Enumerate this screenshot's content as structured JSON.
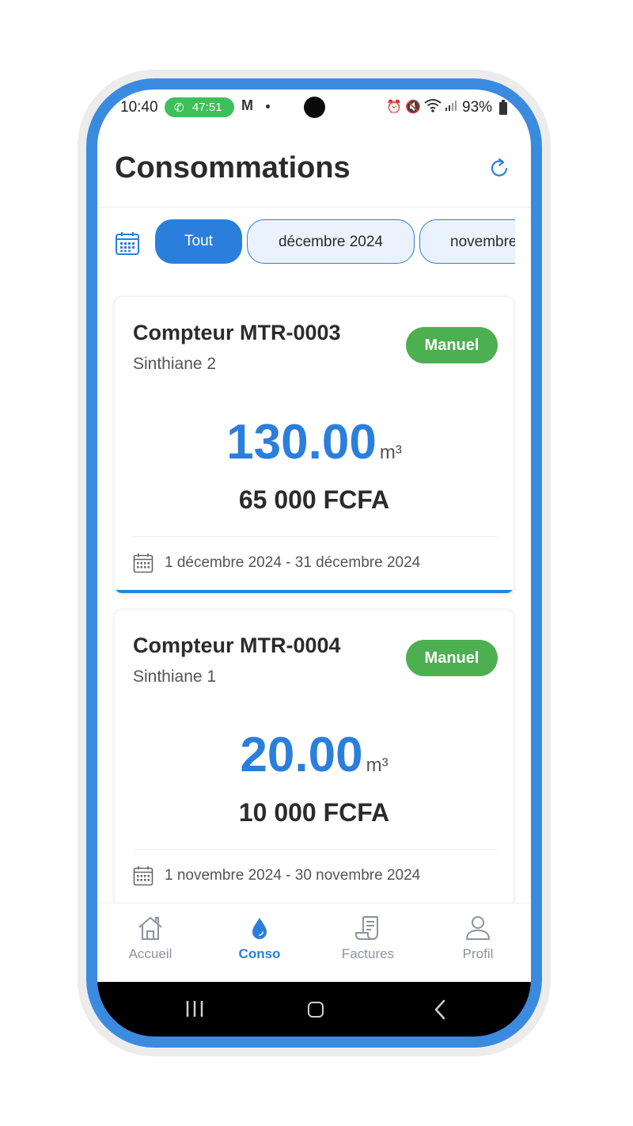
{
  "status_bar": {
    "time": "10:40",
    "call_duration": "47:51",
    "battery": "93%"
  },
  "header": {
    "title": "Consommations",
    "accent_color": "#2a7fdc"
  },
  "filters": {
    "chips": [
      {
        "label": "Tout",
        "selected": true
      },
      {
        "label": "décembre 2024",
        "selected": false
      },
      {
        "label": "novembre",
        "selected": false
      }
    ]
  },
  "cards": [
    {
      "meter": "Compteur MTR-0003",
      "site": "Sinthiane 2",
      "badge": "Manuel",
      "volume": "130.00",
      "unit": "m³",
      "amount": "65 000 FCFA",
      "period": "1 décembre 2024 - 31 décembre 2024"
    },
    {
      "meter": "Compteur MTR-0004",
      "site": "Sinthiane 1",
      "badge": "Manuel",
      "volume": "20.00",
      "unit": "m³",
      "amount": "10 000 FCFA",
      "period": "1 novembre 2024 - 30 novembre 2024"
    }
  ],
  "bottom_nav": [
    {
      "label": "Accueil",
      "icon": "home-icon",
      "active": false
    },
    {
      "label": "Conso",
      "icon": "water-drop-icon",
      "active": true
    },
    {
      "label": "Factures",
      "icon": "receipt-icon",
      "active": false
    },
    {
      "label": "Profil",
      "icon": "user-icon",
      "active": false
    }
  ],
  "colors": {
    "primary": "#2a7fdc",
    "badge_green": "#4caf50",
    "call_green": "#3cc15a",
    "nav_inactive": "#8b93a0"
  }
}
